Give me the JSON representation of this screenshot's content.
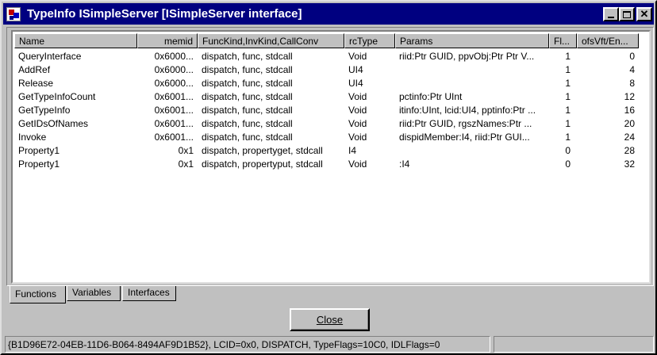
{
  "window": {
    "title": "TypeInfo ISimpleServer [ISimpleServer interface]"
  },
  "columns": [
    {
      "label": "Name",
      "align": "left"
    },
    {
      "label": "memid",
      "align": "right"
    },
    {
      "label": "FuncKind,InvKind,CallConv",
      "align": "left"
    },
    {
      "label": "rcType",
      "align": "left"
    },
    {
      "label": "Params",
      "align": "left"
    },
    {
      "label": "Fl...",
      "align": "left"
    },
    {
      "label": "ofsVft/En...",
      "align": "left"
    }
  ],
  "rows": [
    [
      "QueryInterface",
      "0x6000...",
      "dispatch, func, stdcall",
      "Void",
      "riid:Ptr GUID, ppvObj:Ptr Ptr V...",
      "1",
      "0"
    ],
    [
      "AddRef",
      "0x6000...",
      "dispatch, func, stdcall",
      "UI4",
      "",
      "1",
      "4"
    ],
    [
      "Release",
      "0x6000...",
      "dispatch, func, stdcall",
      "UI4",
      "",
      "1",
      "8"
    ],
    [
      "GetTypeInfoCount",
      "0x6001...",
      "dispatch, func, stdcall",
      "Void",
      "pctinfo:Ptr UInt",
      "1",
      "12"
    ],
    [
      "GetTypeInfo",
      "0x6001...",
      "dispatch, func, stdcall",
      "Void",
      "itinfo:UInt, lcid:UI4, pptinfo:Ptr ...",
      "1",
      "16"
    ],
    [
      "GetIDsOfNames",
      "0x6001...",
      "dispatch, func, stdcall",
      "Void",
      "riid:Ptr GUID, rgszNames:Ptr ...",
      "1",
      "20"
    ],
    [
      "Invoke",
      "0x6001...",
      "dispatch, func, stdcall",
      "Void",
      "dispidMember:I4, riid:Ptr GUI...",
      "1",
      "24"
    ],
    [
      "Property1",
      "0x1",
      "dispatch, propertyget, stdcall",
      "I4",
      "",
      "0",
      "28"
    ],
    [
      "Property1",
      "0x1",
      "dispatch, propertyput, stdcall",
      "Void",
      ":I4",
      "0",
      "32"
    ]
  ],
  "tabs": [
    {
      "label": "Functions",
      "active": true
    },
    {
      "label": "Variables",
      "active": false
    },
    {
      "label": "Interfaces",
      "active": false
    }
  ],
  "buttons": {
    "close": "Close"
  },
  "status": {
    "main": "{B1D96E72-04EB-11D6-B064-8494AF9D1B52}, LCID=0x0, DISPATCH, TypeFlags=10C0, IDLFlags=0",
    "secondary": ""
  }
}
